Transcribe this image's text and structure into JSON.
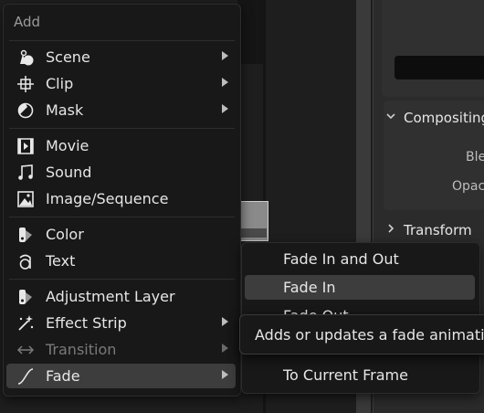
{
  "menu": {
    "title": "Add",
    "items": [
      {
        "label": "Scene",
        "icon": "scene-icon"
      },
      {
        "label": "Clip",
        "icon": "clip-icon"
      },
      {
        "label": "Mask",
        "icon": "mask-icon"
      },
      {
        "label": "Movie",
        "icon": "movie-icon"
      },
      {
        "label": "Sound",
        "icon": "sound-icon"
      },
      {
        "label": "Image/Sequence",
        "icon": "image-icon"
      },
      {
        "label": "Color",
        "icon": "color-icon"
      },
      {
        "label": "Text",
        "icon": "text-icon"
      },
      {
        "label": "Adjustment Layer",
        "icon": "adjustment-layer-icon"
      },
      {
        "label": "Effect Strip",
        "icon": "effect-strip-icon"
      },
      {
        "label": "Transition",
        "icon": "transition-icon"
      },
      {
        "label": "Fade",
        "icon": "fade-icon"
      }
    ]
  },
  "submenu": {
    "items": [
      {
        "label": "Fade In and Out"
      },
      {
        "label": "Fade In"
      },
      {
        "label": "Fade Out"
      },
      {
        "label": "To Current Frame"
      }
    ]
  },
  "tooltip": {
    "text": "Adds or updates a fade animation"
  },
  "properties": {
    "compositing": "Compositing",
    "blend_label": "Blend",
    "opacity_label": "Opacity",
    "transform": "Transform"
  },
  "colors": {
    "menu_bg": "#181818",
    "highlight": "#3d3d3d",
    "text": "#e6e6e6",
    "disabled_text": "#7a7a7a"
  }
}
